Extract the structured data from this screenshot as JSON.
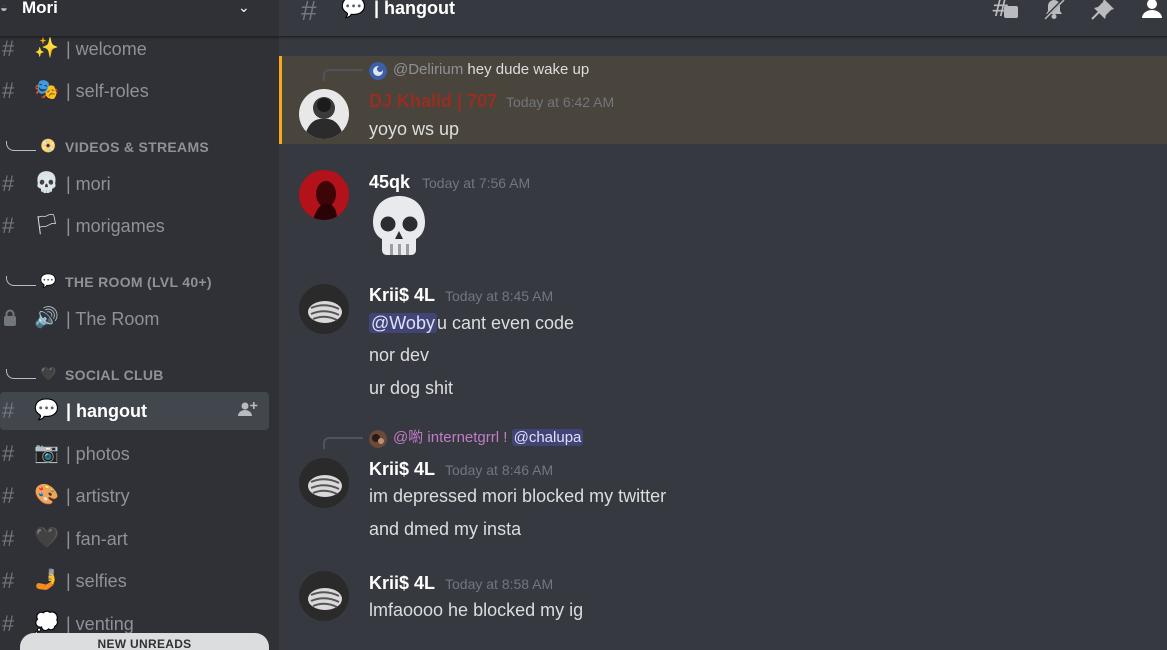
{
  "server": {
    "name": "Mori",
    "icon": "server-icon",
    "chevron": "chevron-down-icon"
  },
  "sidebar": {
    "channels": [
      {
        "emoji": "✨",
        "name": "| welcome"
      },
      {
        "emoji": "🎭",
        "name": "| self-roles"
      },
      {
        "emoji": "💀",
        "name": "| mori"
      },
      {
        "emoji": "🏳",
        "name": "| morigames"
      },
      {
        "emoji": "🔊",
        "name": "| The Room"
      },
      {
        "emoji": "💬",
        "name": "| hangout"
      },
      {
        "emoji": "📷",
        "name": "| photos"
      },
      {
        "emoji": "🎨",
        "name": "| artistry"
      },
      {
        "emoji": "🖤",
        "name": "| fan-art"
      },
      {
        "emoji": "🤳",
        "name": "| selfies"
      },
      {
        "emoji": "💭",
        "name": "| venting"
      }
    ],
    "categories": [
      {
        "emoji": "📀",
        "label": "VIDEOS & STREAMS"
      },
      {
        "emoji": "💬",
        "label": "THE ROOM (LVL 40+)"
      },
      {
        "emoji": "🖤",
        "label": "SOCIAL CLUB"
      }
    ],
    "active_channel": "hangout",
    "new_unreads": "NEW UNREADS"
  },
  "header": {
    "channel_emoji": "💬",
    "channel_title": "| hangout",
    "icons": [
      "threads-icon",
      "mute-bell-icon",
      "pin-icon",
      "member-list-icon"
    ]
  },
  "messages": [
    {
      "reply": {
        "mention": "@Delirium",
        "text": " hey dude wake up"
      },
      "author": "DJ Khalid | 707",
      "author_color": "#992d22",
      "timestamp": "Today at 6:42 AM",
      "lines": [
        "yoyo ws up"
      ],
      "highlighted": true
    },
    {
      "author": "45qk",
      "author_color": "#ffffff",
      "timestamp": "Today at 7:56 AM",
      "emoji_only": "skull"
    },
    {
      "author": "Krii$ 4L",
      "author_color": "#ffffff",
      "timestamp": "Today at 8:45 AM",
      "mention": "@Woby",
      "lines": [
        "u cant even code",
        "nor dev",
        "ur dog shit"
      ]
    },
    {
      "reply": {
        "mention": "@喲 internetgrrl !",
        "mention_color": "#c27cc9",
        "text": "@chalupa"
      },
      "author": "Krii$ 4L",
      "author_color": "#ffffff",
      "timestamp": "Today at 8:46 AM",
      "lines": [
        "im depressed mori blocked my twitter",
        "and dmed my insta"
      ]
    },
    {
      "author": "Krii$ 4L",
      "author_color": "#ffffff",
      "timestamp": "Today at 8:58 AM",
      "lines": [
        "lmfaoooo he blocked my ig"
      ]
    }
  ]
}
